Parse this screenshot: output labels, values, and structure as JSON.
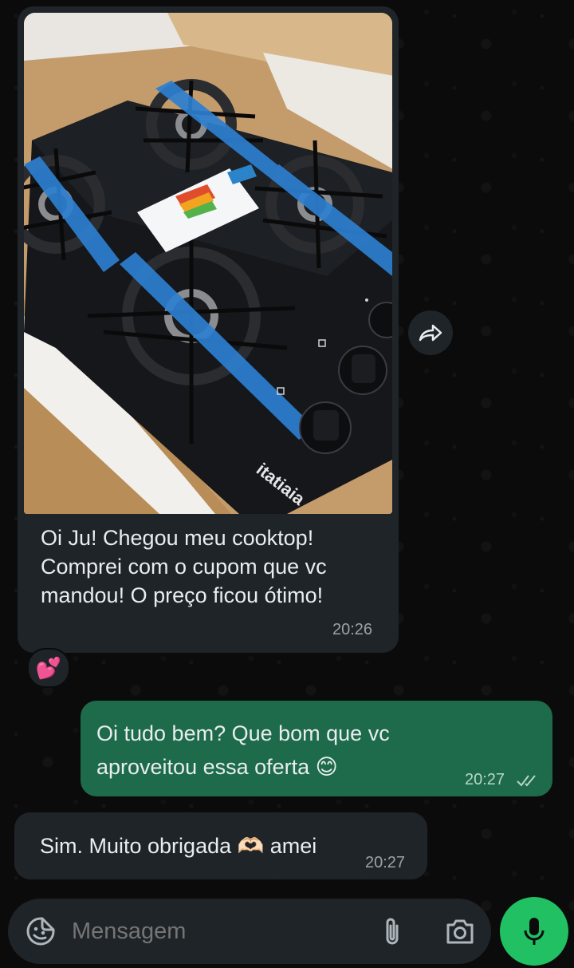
{
  "messages": {
    "incoming_media": {
      "text": "Oi Ju!  Chegou meu cooktop!\nComprei com o cupom que vc\nmandou! O preço ficou ótimo!",
      "time": "20:26",
      "photo_brand": "itatiaia",
      "reaction": "💕"
    },
    "outgoing": {
      "text": "Oi tudo bem? Que bom que vc\naproveitou essa oferta 😊",
      "time": "20:27",
      "status": "read"
    },
    "incoming_small": {
      "text": "Sim. Muito obrigada 🫶🏻 amei",
      "time": "20:27"
    }
  },
  "composer": {
    "placeholder": "Mensagem",
    "icons": [
      "sticker-icon",
      "attach-icon",
      "camera-icon",
      "mic-icon"
    ]
  },
  "colors": {
    "background": "#0b0b0b",
    "incoming_bubble": "#1f2429",
    "outgoing_bubble": "#1d6b4a",
    "mic_button": "#21c063"
  }
}
